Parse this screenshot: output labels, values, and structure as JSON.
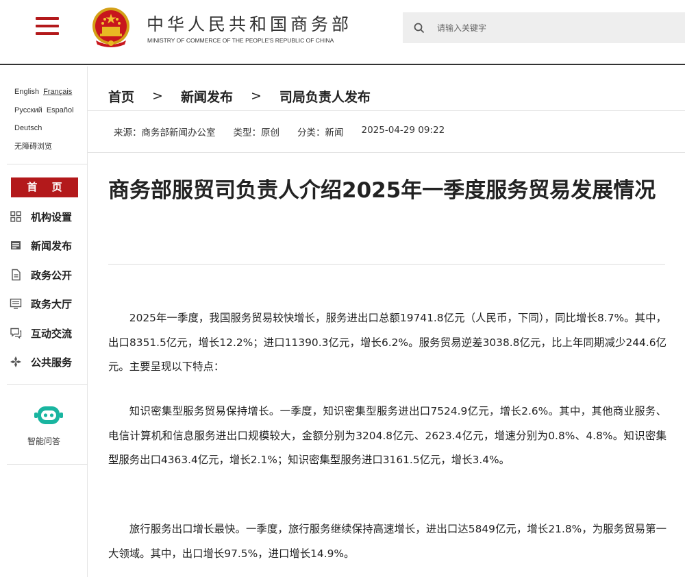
{
  "header": {
    "site_title": "中华人民共和国商务部",
    "site_subtitle": "MINISTRY OF COMMERCE OF THE PEOPLE'S REPUBLIC OF CHINA",
    "search_placeholder": "请输入关键字",
    "brand_color": "#b3191b"
  },
  "sidebar": {
    "languages": [
      "English",
      "Français",
      "Русский",
      "Español",
      "Deutsch",
      "无障碍浏览"
    ],
    "home_label": "首 页",
    "nav_items": [
      {
        "label": "机构设置",
        "icon": "grid-icon"
      },
      {
        "label": "新闻发布",
        "icon": "news-icon"
      },
      {
        "label": "政务公开",
        "icon": "document-icon"
      },
      {
        "label": "政务大厅",
        "icon": "hall-icon"
      },
      {
        "label": "互动交流",
        "icon": "chat-icon"
      },
      {
        "label": "公共服务",
        "icon": "service-icon"
      }
    ],
    "assistant_label": "智能问答",
    "assistant_color": "#19b5a0"
  },
  "breadcrumb": {
    "items": [
      "首页",
      "新闻发布",
      "司局负责人发布"
    ],
    "separator": ">"
  },
  "meta": {
    "source": "来源：商务部新闻办公室",
    "type": "类型：原创",
    "category": "分类：新闻",
    "datetime": "2025-04-29 09:22"
  },
  "article": {
    "title": "商务部服贸司负责人介绍2025年一季度服务贸易发展情况",
    "paragraphs": [
      "2025年一季度，我国服务贸易较快增长，服务进出口总额19741.8亿元（人民币，下同），同比增长8.7%。其中，出口8351.5亿元，增长12.2%；进口11390.3亿元，增长6.2%。服务贸易逆差3038.8亿元，比上年同期减少244.6亿元。主要呈现以下特点：",
      "知识密集型服务贸易保持增长。一季度，知识密集型服务进出口7524.9亿元，增长2.6%。其中，其他商业服务、电信计算机和信息服务进出口规模较大，金额分别为3204.8亿元、2623.4亿元，增速分别为0.8%、4.8%。知识密集型服务出口4363.4亿元，增长2.1%；知识密集型服务进口3161.5亿元，增长3.4%。",
      "旅行服务出口增长最快。一季度，旅行服务继续保持高速增长，进出口达5849亿元，增长21.8%，为服务贸易第一大领域。其中，出口增长97.5%，进口增长14.9%。"
    ]
  }
}
